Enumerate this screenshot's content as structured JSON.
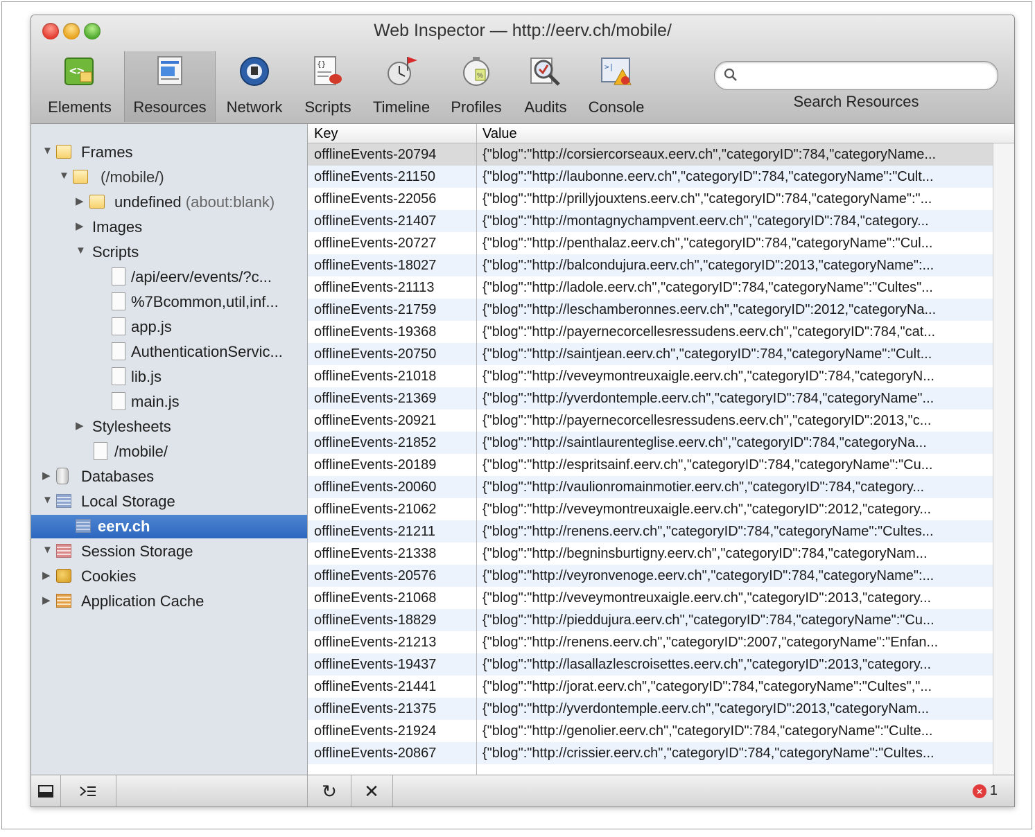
{
  "window": {
    "title": "Web Inspector — http://eerv.ch/mobile/"
  },
  "toolbar": {
    "tools": [
      {
        "label": "Elements",
        "icon": "elements-icon"
      },
      {
        "label": "Resources",
        "icon": "resources-icon"
      },
      {
        "label": "Network",
        "icon": "network-icon"
      },
      {
        "label": "Scripts",
        "icon": "scripts-icon"
      },
      {
        "label": "Timeline",
        "icon": "timeline-icon"
      },
      {
        "label": "Profiles",
        "icon": "profiles-icon"
      },
      {
        "label": "Audits",
        "icon": "audits-icon"
      },
      {
        "label": "Console",
        "icon": "console-icon"
      }
    ],
    "selected": "Resources",
    "search": {
      "value": "",
      "placeholder": "",
      "label": "Search Resources"
    }
  },
  "sidebar": {
    "items": [
      {
        "label": "Frames",
        "expanded": true
      },
      {
        "label": "(/mobile/)",
        "expanded": true
      },
      {
        "label": "undefined",
        "suffix": "(about:blank)",
        "expanded": false
      },
      {
        "label": "Images",
        "expanded": false
      },
      {
        "label": "Scripts",
        "expanded": true
      },
      {
        "label": "/api/eerv/events/?c..."
      },
      {
        "label": "%7Bcommon,util,inf..."
      },
      {
        "label": "app.js"
      },
      {
        "label": "AuthenticationServic..."
      },
      {
        "label": "lib.js"
      },
      {
        "label": "main.js"
      },
      {
        "label": "Stylesheets",
        "expanded": false
      },
      {
        "label": "/mobile/"
      },
      {
        "label": "Databases",
        "expanded": false
      },
      {
        "label": "Local Storage",
        "expanded": true
      },
      {
        "label": "eerv.ch",
        "selected": true
      },
      {
        "label": "Session Storage",
        "expanded": true
      },
      {
        "label": "Cookies",
        "expanded": false
      },
      {
        "label": "Application Cache",
        "expanded": false
      }
    ]
  },
  "table": {
    "columns": [
      "Key",
      "Value"
    ],
    "rows": [
      {
        "key": "offlineEvents-20794",
        "value": "{\"blog\":\"http://corsiercorseaux.eerv.ch\",\"categoryID\":784,\"categoryName..."
      },
      {
        "key": "offlineEvents-21150",
        "value": "{\"blog\":\"http://laubonne.eerv.ch\",\"categoryID\":784,\"categoryName\":\"Cult..."
      },
      {
        "key": "offlineEvents-22056",
        "value": "{\"blog\":\"http://prillyjouxtens.eerv.ch\",\"categoryID\":784,\"categoryName\":\"..."
      },
      {
        "key": "offlineEvents-21407",
        "value": "{\"blog\":\"http://montagnychampvent.eerv.ch\",\"categoryID\":784,\"category..."
      },
      {
        "key": "offlineEvents-20727",
        "value": "{\"blog\":\"http://penthalaz.eerv.ch\",\"categoryID\":784,\"categoryName\":\"Cul..."
      },
      {
        "key": "offlineEvents-18027",
        "value": "{\"blog\":\"http://balcondujura.eerv.ch\",\"categoryID\":2013,\"categoryName\":..."
      },
      {
        "key": "offlineEvents-21113",
        "value": "{\"blog\":\"http://ladole.eerv.ch\",\"categoryID\":784,\"categoryName\":\"Cultes\"..."
      },
      {
        "key": "offlineEvents-21759",
        "value": "{\"blog\":\"http://leschamberonnes.eerv.ch\",\"categoryID\":2012,\"categoryNa..."
      },
      {
        "key": "offlineEvents-19368",
        "value": "{\"blog\":\"http://payernecorcellesressudens.eerv.ch\",\"categoryID\":784,\"cat..."
      },
      {
        "key": "offlineEvents-20750",
        "value": "{\"blog\":\"http://saintjean.eerv.ch\",\"categoryID\":784,\"categoryName\":\"Cult..."
      },
      {
        "key": "offlineEvents-21018",
        "value": "{\"blog\":\"http://veveymontreuxaigle.eerv.ch\",\"categoryID\":784,\"categoryN..."
      },
      {
        "key": "offlineEvents-21369",
        "value": "{\"blog\":\"http://yverdontemple.eerv.ch\",\"categoryID\":784,\"categoryName\"..."
      },
      {
        "key": "offlineEvents-20921",
        "value": "{\"blog\":\"http://payernecorcellesressudens.eerv.ch\",\"categoryID\":2013,\"c..."
      },
      {
        "key": "offlineEvents-21852",
        "value": "{\"blog\":\"http://saintlaurenteglise.eerv.ch\",\"categoryID\":784,\"categoryNa..."
      },
      {
        "key": "offlineEvents-20189",
        "value": "{\"blog\":\"http://espritsainf.eerv.ch\",\"categoryID\":784,\"categoryName\":\"Cu..."
      },
      {
        "key": "offlineEvents-20060",
        "value": "{\"blog\":\"http://vaulionromainmotier.eerv.ch\",\"categoryID\":784,\"category..."
      },
      {
        "key": "offlineEvents-21062",
        "value": "{\"blog\":\"http://veveymontreuxaigle.eerv.ch\",\"categoryID\":2012,\"category..."
      },
      {
        "key": "offlineEvents-21211",
        "value": "{\"blog\":\"http://renens.eerv.ch\",\"categoryID\":784,\"categoryName\":\"Cultes..."
      },
      {
        "key": "offlineEvents-21338",
        "value": "{\"blog\":\"http://begninsburtigny.eerv.ch\",\"categoryID\":784,\"categoryNam..."
      },
      {
        "key": "offlineEvents-20576",
        "value": "{\"blog\":\"http://veyronvenoge.eerv.ch\",\"categoryID\":784,\"categoryName\":..."
      },
      {
        "key": "offlineEvents-21068",
        "value": "{\"blog\":\"http://veveymontreuxaigle.eerv.ch\",\"categoryID\":2013,\"category..."
      },
      {
        "key": "offlineEvents-18829",
        "value": "{\"blog\":\"http://pieddujura.eerv.ch\",\"categoryID\":784,\"categoryName\":\"Cu..."
      },
      {
        "key": "offlineEvents-21213",
        "value": "{\"blog\":\"http://renens.eerv.ch\",\"categoryID\":2007,\"categoryName\":\"Enfan..."
      },
      {
        "key": "offlineEvents-19437",
        "value": "{\"blog\":\"http://lasallazlescroisettes.eerv.ch\",\"categoryID\":2013,\"category..."
      },
      {
        "key": "offlineEvents-21441",
        "value": "{\"blog\":\"http://jorat.eerv.ch\",\"categoryID\":784,\"categoryName\":\"Cultes\",\"..."
      },
      {
        "key": "offlineEvents-21375",
        "value": "{\"blog\":\"http://yverdontemple.eerv.ch\",\"categoryID\":2013,\"categoryNam..."
      },
      {
        "key": "offlineEvents-21924",
        "value": "{\"blog\":\"http://genolier.eerv.ch\",\"categoryID\":784,\"categoryName\":\"Culte..."
      },
      {
        "key": "offlineEvents-20867",
        "value": "{\"blog\":\"http://crissier.eerv.ch\",\"categoryID\":784,\"categoryName\":\"Cultes..."
      }
    ]
  },
  "statusbar": {
    "dock_icon": "dock-icon",
    "console_icon": "console-toggle-icon",
    "refresh_glyph": "↻",
    "delete_glyph": "✕",
    "error_glyph": "×",
    "error_count": "1"
  }
}
